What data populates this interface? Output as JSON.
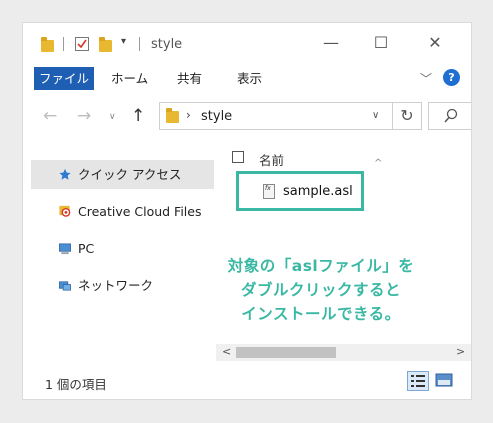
{
  "window": {
    "title": "style"
  },
  "ribbon": {
    "file": "ファイル",
    "tabs": [
      "ホーム",
      "共有",
      "表示"
    ],
    "help": "?"
  },
  "address": {
    "path": "style"
  },
  "nav": {
    "items": [
      {
        "label": "クイック アクセス"
      },
      {
        "label": "Creative Cloud Files"
      },
      {
        "label": "PC"
      },
      {
        "label": "ネットワーク"
      }
    ]
  },
  "content": {
    "column_name": "名前",
    "file": {
      "name": "sample.asl",
      "icon_text": "fx"
    },
    "annotation": [
      "対象の「aslファイル」を",
      "ダブルクリックすると",
      "インストールできる。"
    ]
  },
  "status": {
    "text": "1 個の項目"
  },
  "colors": {
    "accent": "#3bb8a4",
    "file_tab": "#1f5fb3"
  }
}
